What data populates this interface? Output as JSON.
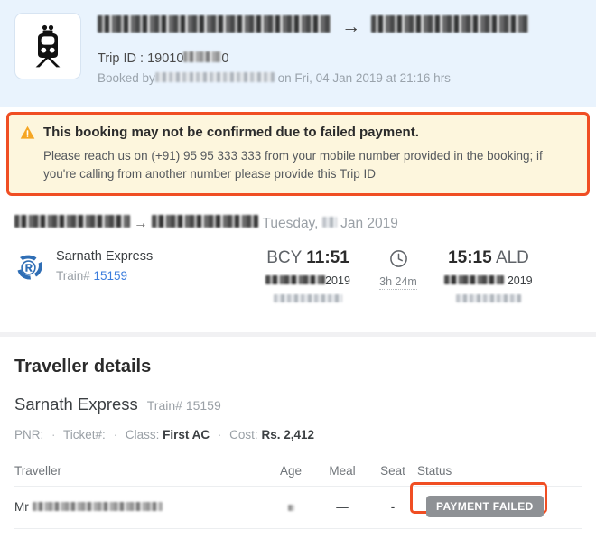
{
  "header": {
    "icon": "train-front-icon",
    "route_title_visible": "",
    "route_title_redacted": true,
    "trip_id_label": "Trip ID : ",
    "trip_id_prefix": "19010",
    "trip_id_suffix": "0",
    "booked_by_label": "Booked by",
    "booked_on": "on Fri, 04 Jan 2019 at 21:16 hrs",
    "bg_color": "#e9f3fd"
  },
  "alert": {
    "icon": "warning-triangle-icon",
    "title": "This booking may not be confirmed due to failed payment.",
    "body": "Please reach us on (+91) 95 95 333 333 from your mobile number provided in the booking; if you're calling from another number please provide this Trip ID",
    "bg_color": "#fdf6dd",
    "highlight_color": "#f04e23"
  },
  "journey": {
    "date_suffix": "Tuesday,",
    "date_tail": "Jan 2019",
    "rail_logo": "indian-railways-logo-icon",
    "train_name": "Sarnath Express",
    "train_number_label": "Train# ",
    "train_number": "15159",
    "departure": {
      "station_code": "BCY",
      "time": "11:51",
      "date_tail": "2019"
    },
    "duration": {
      "icon": "clock-icon",
      "text": "3h 24m"
    },
    "arrival": {
      "time": "15:15",
      "station_code": "ALD",
      "date_tail": "2019"
    }
  },
  "traveller_details": {
    "section_title": "Traveller details",
    "train_name": "Sarnath Express",
    "train_number_label": "Train# ",
    "train_number": "15159",
    "facts": {
      "pnr_label": "PNR:",
      "pnr_value": "",
      "ticket_label": "Ticket#:",
      "ticket_value": "",
      "class_label": "Class:",
      "class_value": "First AC",
      "cost_label": "Cost:",
      "cost_value": "Rs. 2,412",
      "separator": "·"
    },
    "table": {
      "columns": [
        "Traveller",
        "Age",
        "Meal",
        "Seat",
        "Status"
      ],
      "rows": [
        {
          "traveller_prefix": "Mr",
          "traveller_name_redacted": true,
          "age": "",
          "meal": "—",
          "seat": "-",
          "status": "PAYMENT FAILED",
          "status_color": "#8e9195"
        }
      ]
    }
  }
}
